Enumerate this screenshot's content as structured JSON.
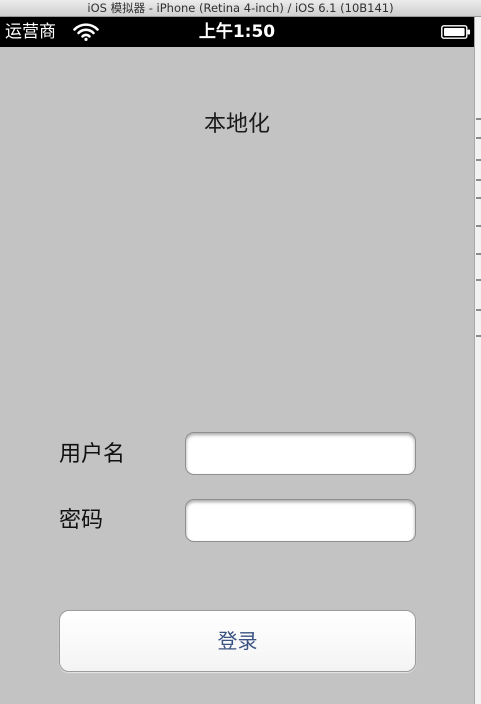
{
  "simulator": {
    "title": "iOS 模拟器 - iPhone (Retina 4-inch) / iOS 6.1 (10B141)"
  },
  "status_bar": {
    "carrier": "运营商",
    "time": "上午1:50",
    "wifi_icon": "wifi-icon",
    "battery_icon": "battery-full-icon"
  },
  "screen": {
    "title": "本地化",
    "username_label": "用户名",
    "username_value": "",
    "password_label": "密码",
    "password_value": "",
    "login_button_label": "登录"
  },
  "colors": {
    "background": "#c3c3c3",
    "button_text": "#3a5282",
    "status_bar": "#000000"
  }
}
